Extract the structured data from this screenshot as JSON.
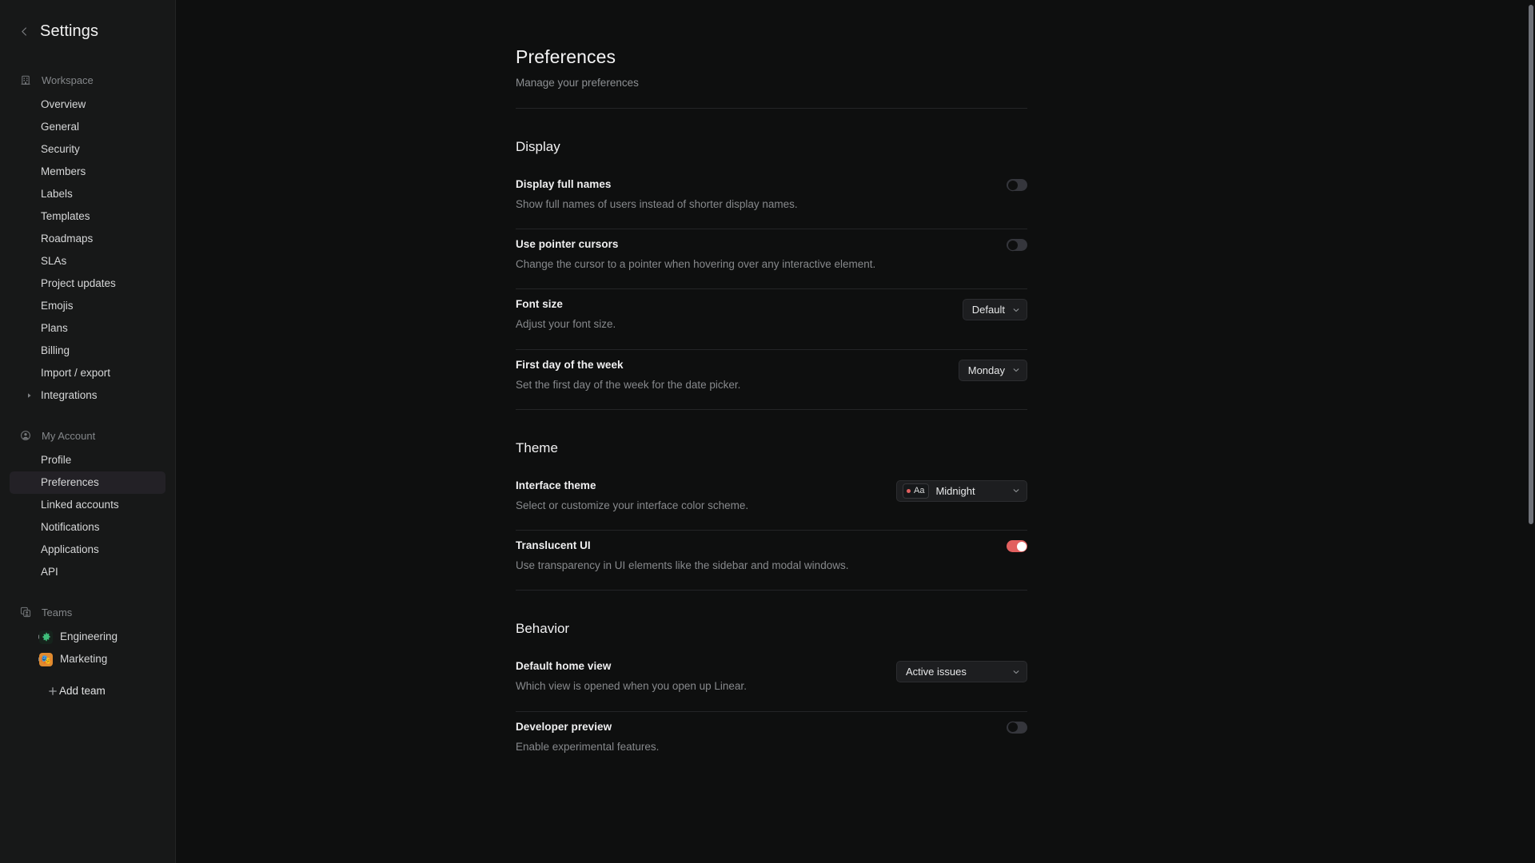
{
  "sidebar": {
    "title": "Settings",
    "back_icon": "chevron-left-icon",
    "groups": [
      {
        "id": "workspace",
        "label": "Workspace",
        "icon": "building-icon",
        "items": [
          {
            "label": "Overview",
            "expandable": false,
            "active": false
          },
          {
            "label": "General",
            "expandable": false,
            "active": false
          },
          {
            "label": "Security",
            "expandable": false,
            "active": false
          },
          {
            "label": "Members",
            "expandable": false,
            "active": false
          },
          {
            "label": "Labels",
            "expandable": false,
            "active": false
          },
          {
            "label": "Templates",
            "expandable": false,
            "active": false
          },
          {
            "label": "Roadmaps",
            "expandable": false,
            "active": false
          },
          {
            "label": "SLAs",
            "expandable": false,
            "active": false
          },
          {
            "label": "Project updates",
            "expandable": false,
            "active": false
          },
          {
            "label": "Emojis",
            "expandable": false,
            "active": false
          },
          {
            "label": "Plans",
            "expandable": false,
            "active": false
          },
          {
            "label": "Billing",
            "expandable": false,
            "active": false
          },
          {
            "label": "Import / export",
            "expandable": false,
            "active": false
          },
          {
            "label": "Integrations",
            "expandable": true,
            "active": false
          }
        ]
      },
      {
        "id": "my-account",
        "label": "My Account",
        "icon": "user-circle-icon",
        "items": [
          {
            "label": "Profile",
            "expandable": false,
            "active": false
          },
          {
            "label": "Preferences",
            "expandable": false,
            "active": true
          },
          {
            "label": "Linked accounts",
            "expandable": false,
            "active": false
          },
          {
            "label": "Notifications",
            "expandable": false,
            "active": false
          },
          {
            "label": "Applications",
            "expandable": false,
            "active": false
          },
          {
            "label": "API",
            "expandable": false,
            "active": false
          }
        ]
      },
      {
        "id": "teams",
        "label": "Teams",
        "icon": "teams-icon",
        "teams": [
          {
            "label": "Engineering",
            "badge_glyph": "⚙",
            "badge_color": "#2f9e68",
            "badge_bg": "#1a2a21"
          },
          {
            "label": "Marketing",
            "badge_glyph": "🎭",
            "badge_color": "#e08a2e",
            "badge_bg": "#e08a2e"
          }
        ],
        "add_team_label": "Add team",
        "add_team_icon": "plus-icon"
      }
    ]
  },
  "page": {
    "title": "Preferences",
    "subtitle": "Manage your preferences"
  },
  "sections": [
    {
      "id": "display",
      "title": "Display",
      "rows": [
        {
          "id": "display-full-names",
          "label": "Display full names",
          "desc": "Show full names of users instead of shorter display names.",
          "control": "toggle",
          "value": "off"
        },
        {
          "id": "use-pointer-cursors",
          "label": "Use pointer cursors",
          "desc": "Change the cursor to a pointer when hovering over any interactive element.",
          "control": "toggle",
          "value": "off"
        },
        {
          "id": "font-size",
          "label": "Font size",
          "desc": "Adjust your font size.",
          "control": "dropdown",
          "value": "Default"
        },
        {
          "id": "first-day-of-week",
          "label": "First day of the week",
          "desc": "Set the first day of the week for the date picker.",
          "control": "dropdown",
          "value": "Monday"
        }
      ]
    },
    {
      "id": "theme",
      "title": "Theme",
      "rows": [
        {
          "id": "interface-theme",
          "label": "Interface theme",
          "desc": "Select or customize your interface color scheme.",
          "control": "theme-dropdown",
          "value": "Midnight",
          "chip_text": "Aa",
          "chip_dot_color": "#e2605f"
        },
        {
          "id": "translucent-ui",
          "label": "Translucent UI",
          "desc": "Use transparency in UI elements like the sidebar and modal windows.",
          "control": "toggle",
          "value": "on"
        }
      ]
    },
    {
      "id": "behavior",
      "title": "Behavior",
      "rows": [
        {
          "id": "default-home-view",
          "label": "Default home view",
          "desc": "Which view is opened when you open up Linear.",
          "control": "dropdown",
          "value": "Active issues"
        },
        {
          "id": "developer-preview",
          "label": "Developer preview",
          "desc": "Enable experimental features.",
          "control": "toggle",
          "value": "off"
        }
      ]
    }
  ],
  "colors": {
    "accent": "#e2605f",
    "sidebar_bg": "#171818",
    "main_bg": "#0e0f0f",
    "active_item_bg": "#232126"
  }
}
